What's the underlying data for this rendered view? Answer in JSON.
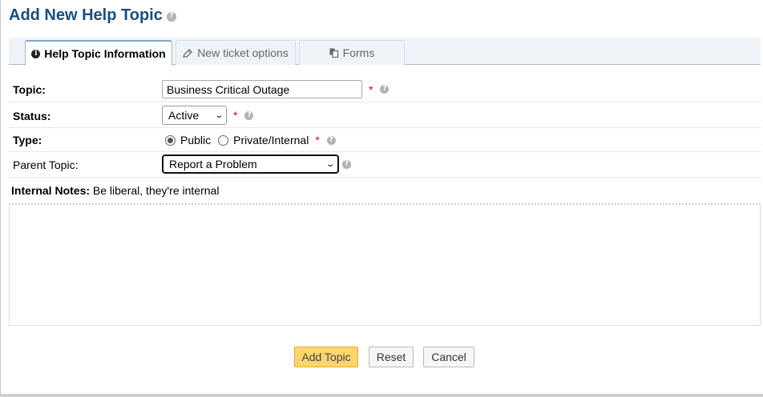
{
  "page": {
    "title": "Add New Help Topic"
  },
  "tabs": [
    {
      "label": "Help Topic Information",
      "icon": "info-circle-icon",
      "active": true
    },
    {
      "label": "New ticket options",
      "icon": "pencil-icon",
      "active": false
    },
    {
      "label": "Forms",
      "icon": "copy-icon",
      "active": false
    }
  ],
  "form": {
    "topic": {
      "label": "Topic:",
      "value": "Business Critical Outage"
    },
    "status": {
      "label": "Status:",
      "selected": "Active"
    },
    "type": {
      "label": "Type:",
      "options": [
        "Public",
        "Private/Internal"
      ],
      "selected": "Public"
    },
    "parent_topic": {
      "label": "Parent Topic:",
      "selected": "Report a Problem"
    },
    "internal_notes": {
      "label": "Internal Notes:",
      "hint": "Be liberal, they're internal"
    },
    "required_marker": "*"
  },
  "buttons": {
    "submit": "Add Topic",
    "reset": "Reset",
    "cancel": "Cancel"
  },
  "colors": {
    "title": "#184e81",
    "primary_button": "#fcd56c",
    "required": "#dd0000"
  }
}
